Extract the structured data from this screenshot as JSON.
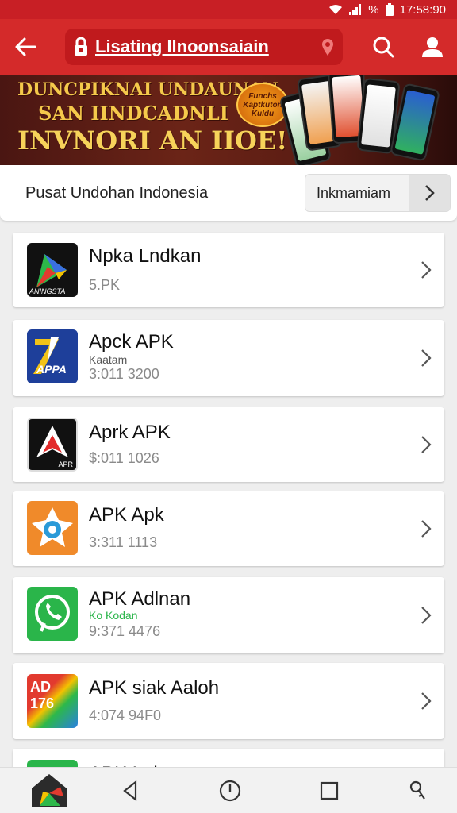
{
  "status_bar": {
    "icons": [
      "wifi-icon",
      "signal-icon",
      "battery-icon"
    ],
    "percent_text": "%",
    "time": "17:58:90"
  },
  "app_bar": {
    "title": "Lisating Ilnoonsaiain",
    "icons": [
      "back-arrow-icon",
      "lock-icon",
      "location-pin-icon",
      "search-icon",
      "account-icon"
    ]
  },
  "banner": {
    "line1": "DUNCPIKNAI UNDAUNAN",
    "line2": "SAN IINDCADNLI",
    "line3": "INVNORI AN IIOE!",
    "badge": "Funchs Kaptkuton Kuldu"
  },
  "header": {
    "title": "Pusat Undohan Indonesia",
    "button_label": "Inkmamiam"
  },
  "apps": [
    {
      "name": "Npka Lndkan",
      "sub": "",
      "meta": "5.PK",
      "icon_text": "ANINGSTA"
    },
    {
      "name": "Apck APK",
      "sub": "Kaatam",
      "meta": "3:011 3200",
      "icon_text": "APPA"
    },
    {
      "name": "Aprk APK",
      "sub": "",
      "meta": "$:011 1026",
      "icon_text": "APR"
    },
    {
      "name": "APK Apk",
      "sub": "",
      "meta": "3:311 1113",
      "icon_text": ""
    },
    {
      "name": "APK Adlnan",
      "sub": "Ko Kodan",
      "meta": "9:371 4476",
      "icon_text": ""
    },
    {
      "name": "APK siak Aaloh",
      "sub": "",
      "meta": "4:074 94F0",
      "icon_text": "AD 176"
    },
    {
      "name": "APK Lnk",
      "sub": "",
      "meta": "",
      "icon_text": ""
    }
  ],
  "colors": {
    "primary": "#d42a2a",
    "status": "#c81f25",
    "banner_text": "#f5c94b"
  },
  "nav_bar": {
    "icons": [
      "app-logo-icon",
      "back-triangle-icon",
      "clock-icon",
      "square-icon",
      "key-icon"
    ]
  }
}
